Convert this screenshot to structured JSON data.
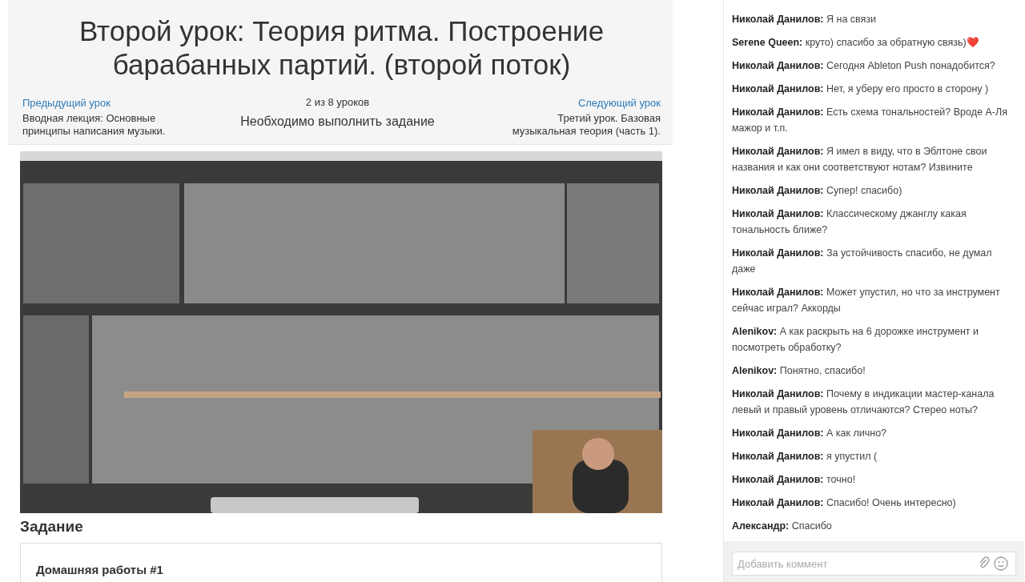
{
  "lesson": {
    "title": "Второй урок: Теория ритма. Построение барабанных партий. (второй поток)",
    "prev": {
      "link": "Предыдущий урок",
      "name": "Вводная лекция: Основные принципы написания музыки."
    },
    "progress": "2 из 8 уроков",
    "requirement": "Необходимо выполнить задание",
    "next": {
      "link": "Следующий урок",
      "name": "Третий урок. Базовая музыкальная теория (часть 1)."
    }
  },
  "task": {
    "heading": "Задание",
    "card_title": "Домашняя работы #1"
  },
  "chat": {
    "messages": [
      {
        "author": "Николай Данилов:",
        "text": "Я на связи"
      },
      {
        "author": "Serene Queen:",
        "text": "круто) спасибо за обратную связь)❤️"
      },
      {
        "author": "Николай Данилов:",
        "text": "Сегодня Ableton Push понадобится?"
      },
      {
        "author": "Николай Данилов:",
        "text": "Нет, я уберу его просто в сторону )"
      },
      {
        "author": "Николай Данилов:",
        "text": "Есть схема тональностей? Вроде А-Ля мажор и т.п."
      },
      {
        "author": "Николай Данилов:",
        "text": "Я имел в виду, что в Эблтоне свои названия и как они соответствуют нотам? Извините"
      },
      {
        "author": "Николай Данилов:",
        "text": "Супер! спасибо)"
      },
      {
        "author": "Николай Данилов:",
        "text": "Классическому джанглу какая тональность ближе?"
      },
      {
        "author": "Николай Данилов:",
        "text": "За устойчивость спасибо, не думал даже"
      },
      {
        "author": "Николай Данилов:",
        "text": "Может упустил, но что за инструмент сейчас играл? Аккорды"
      },
      {
        "author": "Alenikov:",
        "text": "А как раскрыть на 6 дорожке инструмент и посмотреть обработку?"
      },
      {
        "author": "Alenikov:",
        "text": "Понятно, спасибо!"
      },
      {
        "author": "Николай Данилов:",
        "text": "Почему в индикации мастер-канала левый и правый уровень отличаются? Стерео ноты?"
      },
      {
        "author": "Николай Данилов:",
        "text": "А как лично?"
      },
      {
        "author": "Николай Данилов:",
        "text": "я упустил ("
      },
      {
        "author": "Николай Данилов:",
        "text": "точно!"
      },
      {
        "author": "Николай Данилов:",
        "text": "Спасибо! Очень интересно)"
      },
      {
        "author": "Александр:",
        "text": "Спасибо"
      }
    ],
    "input": {
      "placeholder": "Добавить коммент"
    }
  }
}
